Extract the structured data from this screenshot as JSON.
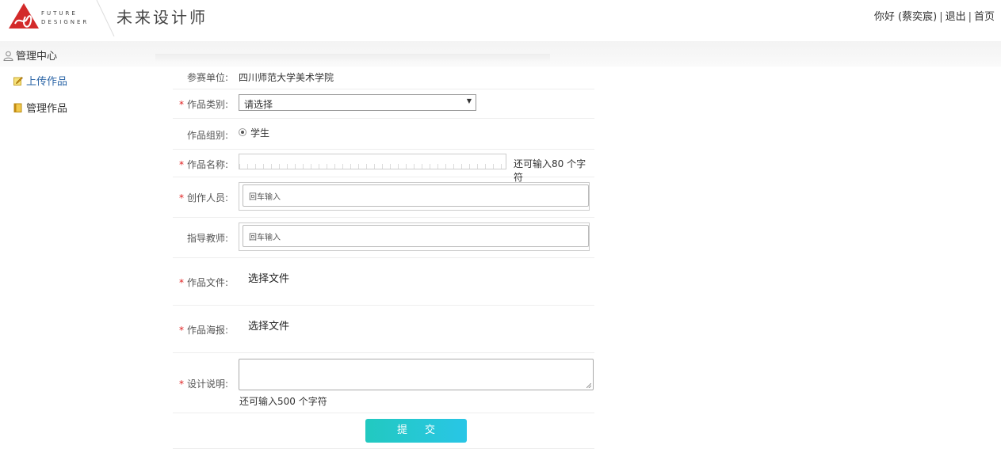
{
  "header": {
    "logo_line1": "FUTURE",
    "logo_line2": "DESIGNER",
    "site_title": "未来设计师",
    "greeting": "你好 (蔡奕宸)",
    "separator": "|",
    "logout": "退出",
    "home": "首页"
  },
  "sidebar": {
    "title": "管理中心",
    "items": [
      {
        "label": "上传作品"
      },
      {
        "label": "管理作品"
      }
    ]
  },
  "form": {
    "unit_label": "参赛单位:",
    "unit_value": "四川师范大学美术学院",
    "required_mark": "*",
    "category_label": "作品类别:",
    "category_value": "请选择",
    "group_label": "作品组别:",
    "group_value": "学生",
    "name_label": "作品名称:",
    "name_remaining": "还可输入80 个字符",
    "creators_label": "创作人员:",
    "creators_placeholder": "回车输入",
    "advisors_label": "指导教师:",
    "advisors_placeholder": "回车输入",
    "file_label": "作品文件:",
    "file_button": "选择文件",
    "poster_label": "作品海报:",
    "poster_button": "选择文件",
    "desc_label": "设计说明:",
    "desc_remaining": "还可输入500 个字符",
    "submit": "提交"
  },
  "colors": {
    "accent_link": "#2a64a6",
    "required": "#e02020",
    "submit_start": "#22c9c0",
    "submit_end": "#29c6e6",
    "logo_red": "#d32a2a"
  }
}
